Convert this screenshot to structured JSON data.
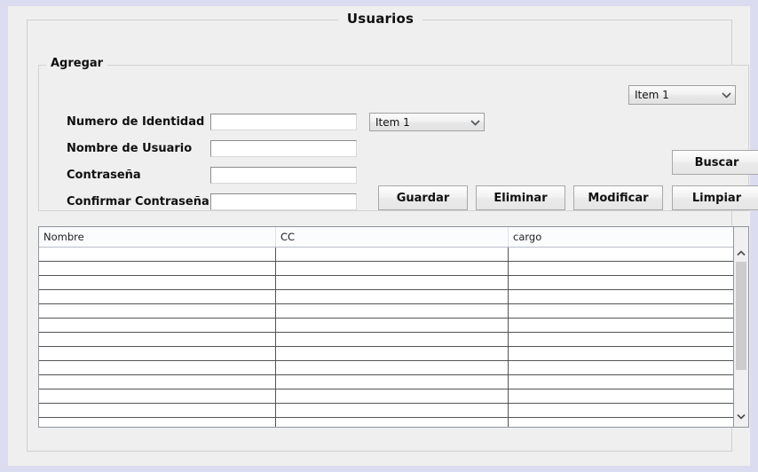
{
  "window": {
    "panel_title": "Usuarios"
  },
  "agregar_group": {
    "legend": "Agregar",
    "fields": [
      {
        "label": "Numero de Identidad",
        "value": "",
        "placeholder": ""
      },
      {
        "label": "Nombre de Usuario",
        "value": "",
        "placeholder": ""
      },
      {
        "label": "Contraseña",
        "value": "",
        "placeholder": ""
      },
      {
        "label": "Confirmar Contraseña",
        "value": "",
        "placeholder": ""
      }
    ],
    "combo_top_right": {
      "selected": "Item 1",
      "arrow": "chevron-down-icon"
    },
    "combo_inline": {
      "selected": "Item 1",
      "arrow": "chevron-down-icon"
    },
    "buttons": {
      "buscar": "Buscar",
      "guardar": "Guardar",
      "eliminar": "Eliminar",
      "modificar": "Modificar",
      "limpiar": "Limpiar"
    }
  },
  "table": {
    "columns": [
      "Nombre",
      "CC",
      "cargo"
    ],
    "rows": [
      [
        "",
        "",
        ""
      ],
      [
        "",
        "",
        ""
      ],
      [
        "",
        "",
        ""
      ],
      [
        "",
        "",
        ""
      ],
      [
        "",
        "",
        ""
      ],
      [
        "",
        "",
        ""
      ],
      [
        "",
        "",
        ""
      ],
      [
        "",
        "",
        ""
      ],
      [
        "",
        "",
        ""
      ],
      [
        "",
        "",
        ""
      ],
      [
        "",
        "",
        ""
      ],
      [
        "",
        "",
        ""
      ],
      [
        "",
        "",
        ""
      ]
    ],
    "scrollbar": {
      "up_arrow": "chevron-up-icon",
      "down_arrow": "chevron-down-icon"
    }
  },
  "colors": {
    "window_edge": "#dcdcf0",
    "panel_bg": "#efefef",
    "field_bg": "#ffffff",
    "grid_line": "#545454",
    "scroll_thumb": "#cdcdcd"
  }
}
